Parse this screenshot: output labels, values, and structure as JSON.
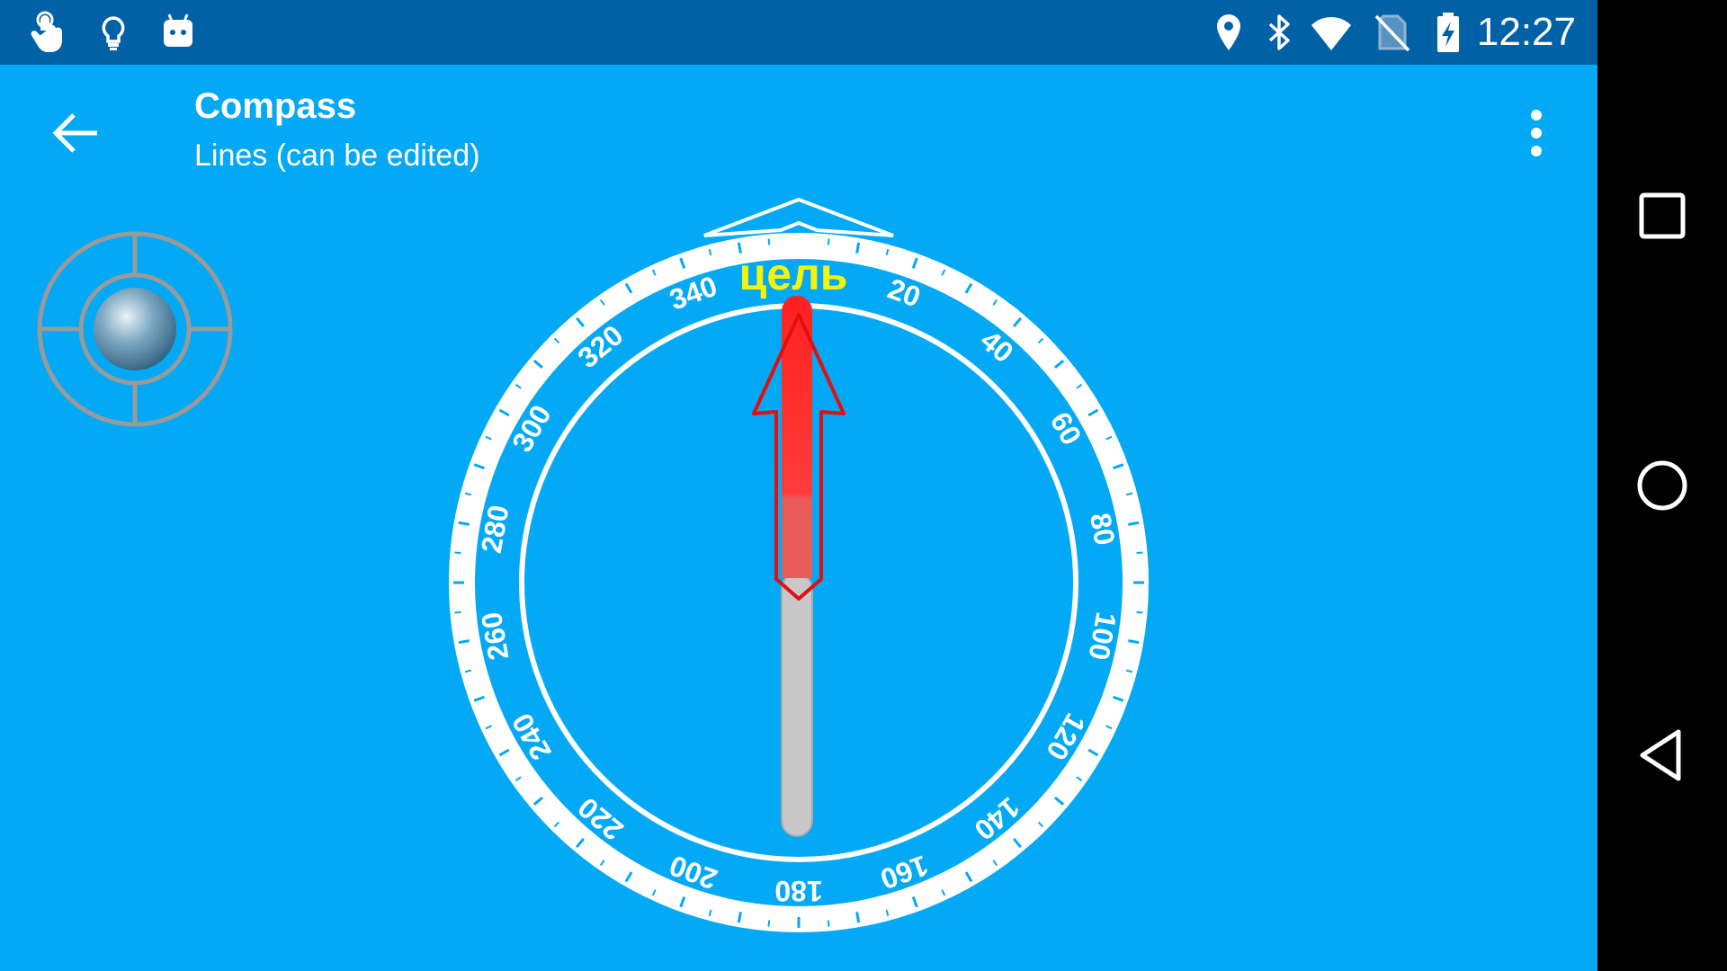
{
  "status_bar": {
    "time": "12:27",
    "icons": [
      "touch-icon",
      "lightbulb-icon",
      "android-icon",
      "location-icon",
      "bluetooth-icon",
      "wifi-icon",
      "no-sim-icon",
      "battery-charging-icon"
    ]
  },
  "app_bar": {
    "title": "Compass",
    "subtitle": "Lines (can be edited)",
    "back_icon": "arrow-back-icon",
    "menu_icon": "more-vert-icon"
  },
  "compass": {
    "target_label": "цель",
    "dial_labels": [
      "20",
      "40",
      "60",
      "80",
      "100",
      "120",
      "140",
      "160",
      "180",
      "200",
      "220",
      "240",
      "260",
      "280",
      "300",
      "320",
      "340"
    ],
    "needle_heading_deg": 0,
    "colors": {
      "background": "#03A9F4",
      "ring": "#FFFFFF",
      "target_label": "#F4F40A",
      "needle_north": "#F21B1B",
      "needle_south": "#C8C8C8",
      "target_arrow": "#E01010"
    }
  },
  "nav_bar": {
    "icons": [
      "recents-icon",
      "home-icon",
      "back-icon"
    ]
  }
}
